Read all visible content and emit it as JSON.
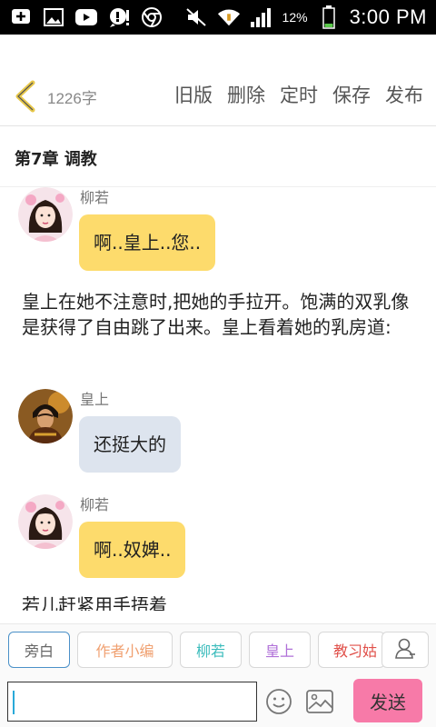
{
  "status_bar": {
    "battery": "12%",
    "time": "3:00 PM"
  },
  "toolbar": {
    "word_count": "1226字",
    "buttons": [
      "旧版",
      "删除",
      "定时",
      "保存",
      "发布"
    ]
  },
  "chapter": {
    "title": "第7章 调教"
  },
  "messages": [
    {
      "speaker": "柳若",
      "text": "啊..皇上..您..",
      "bubble": "yellow",
      "avatar": "woman-avatar"
    },
    {
      "narration": "皇上在她不注意时,把她的手拉开。饱满的双乳像是获得了自由跳了出来。皇上看着她的乳房道:"
    },
    {
      "speaker": "皇上",
      "text": "还挺大的",
      "bubble": "grey",
      "avatar": "emperor-avatar"
    },
    {
      "speaker": "柳若",
      "text": "啊..奴婢..",
      "bubble": "yellow",
      "avatar": "woman-avatar"
    },
    {
      "narration": "若儿赶紧用手捂着"
    }
  ],
  "roles": [
    {
      "label": "旁白",
      "color": "#666666"
    },
    {
      "label": "作者小编",
      "color": "#f0a070"
    },
    {
      "label": "柳若",
      "color": "#3bbcbc"
    },
    {
      "label": "皇上",
      "color": "#b070d8"
    },
    {
      "label": "教习姑",
      "color": "#e0504a"
    }
  ],
  "input": {
    "value": "",
    "send_label": "发送"
  },
  "colors": {
    "accent_yellow": "#fddb6c",
    "bubble_grey": "#dde4ee",
    "send_pink": "#f77aa8",
    "back_yellow": "#e8c84a"
  }
}
